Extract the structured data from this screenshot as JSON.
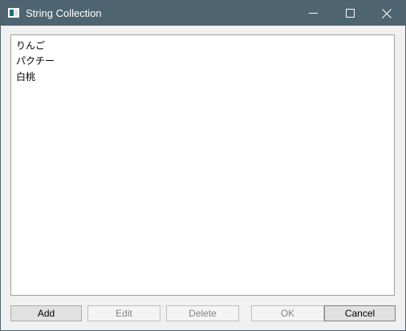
{
  "window": {
    "title": "String Collection",
    "icon": "window-app-icon"
  },
  "caption_buttons": {
    "minimize": "minimize-icon",
    "maximize": "maximize-icon",
    "close": "close-icon"
  },
  "list": {
    "items": [
      "りんご",
      "パクチー",
      "白桃"
    ]
  },
  "buttons": {
    "add": "Add",
    "edit": "Edit",
    "delete": "Delete",
    "ok": "OK",
    "cancel": "Cancel"
  },
  "colors": {
    "titlebar": "#4e6470",
    "window_bg": "#f0f0f0",
    "button_bg": "#e1e1e1",
    "disabled_text": "#838383"
  }
}
